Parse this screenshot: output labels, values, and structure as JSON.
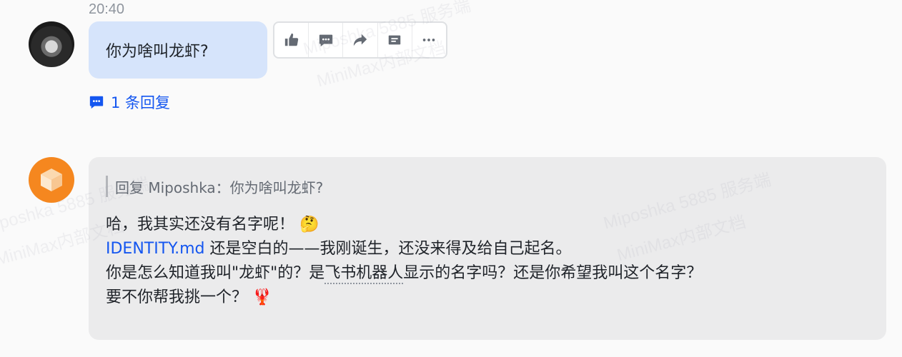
{
  "watermark": {
    "line1": "Miposhka 5885 服务端",
    "line2": "MiniMax内部文档"
  },
  "message_user": {
    "time": "20:40",
    "text": "你为啥叫龙虾?",
    "reply_count_label": "1 条回复"
  },
  "toolbar": {
    "icons": [
      "thumbs-up-icon",
      "comment-icon",
      "forward-icon",
      "quote-reply-icon",
      "more-icon"
    ]
  },
  "message_bot": {
    "quote_text": "回复 Miposhka：你为啥叫龙虾?",
    "line1": "哈，我其实还没有名字呢！",
    "line1_emoji": "🤔",
    "line2_link": "IDENTITY.md",
    "line2_rest": " 还是空白的——我刚诞生，还没来得及给自己起名。",
    "line3_pre": "你是怎么知道我叫\"龙虾\"的？是",
    "line3_entity": "飞书机器人",
    "line3_post": "显示的名字吗？还是你希望我叫这个名字？",
    "line4": "要不你帮我挑一个？",
    "line4_emoji": "🦞"
  },
  "colors": {
    "user_bubble": "#d6e4fb",
    "bot_bubble": "#ebebec",
    "link": "#1456f0",
    "bot_avatar": "#f5871f"
  }
}
